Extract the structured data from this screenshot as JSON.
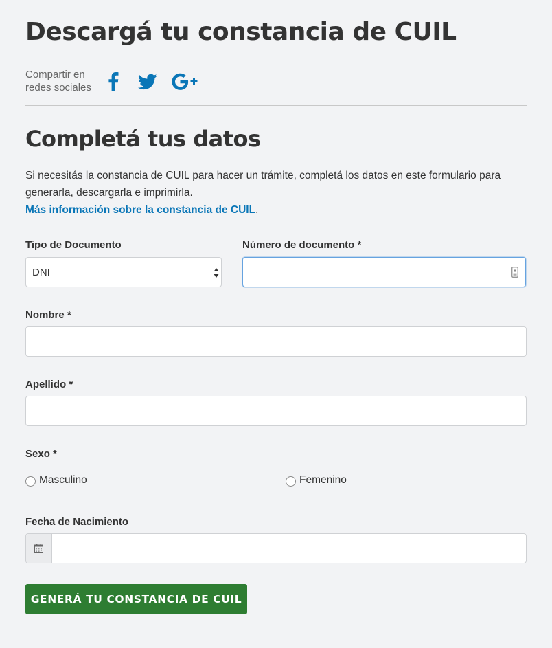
{
  "page": {
    "title": "Descargá tu constancia de CUIL"
  },
  "share": {
    "label_line1": "Compartir en",
    "label_line2": "redes sociales",
    "icons": [
      "facebook-icon",
      "twitter-icon",
      "google-plus-icon"
    ],
    "color": "#0a76b7"
  },
  "form": {
    "heading": "Completá tus datos",
    "intro": "Si necesitás la constancia de CUIL para hacer un trámite, completá los datos en este formulario para generarla, descargarla e imprimirla.",
    "more_info_link": "Más información sobre la constancia de CUIL",
    "more_info_suffix": ".",
    "tipo_documento": {
      "label": "Tipo de Documento",
      "value": "DNI"
    },
    "numero_documento": {
      "label": "Número de documento *",
      "value": ""
    },
    "nombre": {
      "label": "Nombre *",
      "value": ""
    },
    "apellido": {
      "label": "Apellido *",
      "value": ""
    },
    "sexo": {
      "label": "Sexo *",
      "options": [
        "Masculino",
        "Femenino"
      ]
    },
    "fecha_nacimiento": {
      "label": "Fecha de Nacimiento",
      "value": ""
    },
    "submit_label": "GENERÁ TU CONSTANCIA DE CUIL",
    "submit_color": "#2e7d32"
  }
}
